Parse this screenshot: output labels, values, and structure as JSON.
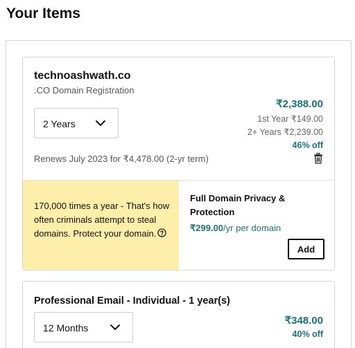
{
  "page": {
    "title": "Your Items"
  },
  "domain_item": {
    "name": "technoashwath.co",
    "type": ".CO Domain Registration",
    "term_selected": "2 Years",
    "price": "₹2,388.00",
    "first_year": "1st Year ₹149.00",
    "later_years": "2+ Years ₹2,239.00",
    "discount": "46% off",
    "renews": "Renews July 2023 for ₹4,478.00 (2-yr term)",
    "promo": {
      "text": "170,000 times a year - That's how often criminals attempt to steal domains. Protect your domain."
    },
    "addon": {
      "title": "Full Domain Privacy & Protection",
      "price_amount": "₹299.00",
      "price_unit": "/yr per domain",
      "add_label": "Add"
    }
  },
  "email_item": {
    "title": "Professional Email - Individual - 1 year(s)",
    "term_selected": "12 Months",
    "price": "₹348.00",
    "discount": "40% off"
  },
  "icons": {
    "term_dropdown": "chevron-down-icon",
    "delete": "trash-icon",
    "help": "question-circle-icon"
  },
  "colors": {
    "accent_teal": "#1a7376",
    "promo_background": "#fdeeaa"
  }
}
